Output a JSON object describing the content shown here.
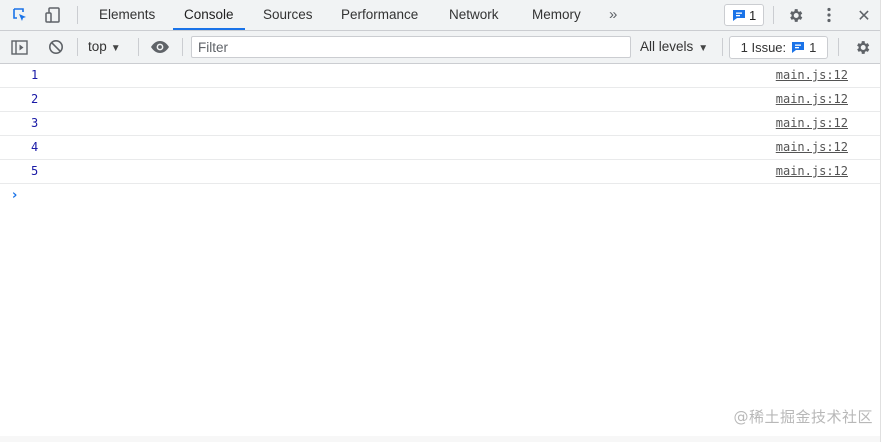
{
  "tabs": [
    {
      "label": "Elements",
      "active": false
    },
    {
      "label": "Console",
      "active": true
    },
    {
      "label": "Sources",
      "active": false
    },
    {
      "label": "Performance",
      "active": false
    },
    {
      "label": "Network",
      "active": false
    },
    {
      "label": "Memory",
      "active": false
    }
  ],
  "more_tabs_glyph": "»",
  "issue_badge_count": "1",
  "close_glyph": "✕",
  "toolbar": {
    "context": "top",
    "filter_placeholder": "Filter",
    "levels": "All levels",
    "issues_label": "1 Issue:",
    "issues_count": "1"
  },
  "messages": [
    {
      "text": "1",
      "source": "main.js:12"
    },
    {
      "text": "2",
      "source": "main.js:12"
    },
    {
      "text": "3",
      "source": "main.js:12"
    },
    {
      "text": "4",
      "source": "main.js:12"
    },
    {
      "text": "5",
      "source": "main.js:12"
    }
  ],
  "prompt_glyph": "›",
  "watermark": "@稀土掘金技术社区",
  "colors": {
    "accent": "#1a73e8",
    "message_text": "#1a1aa6",
    "toolbar_bg": "#f1f3f4"
  },
  "icons": {
    "inspect": "inspect-element-icon",
    "device": "device-toolbar-icon",
    "sidebar": "show-sidebar-icon",
    "clear": "clear-console-icon",
    "eye": "live-expression-icon",
    "settings": "gear-icon",
    "menu": "kebab-menu-icon",
    "issue": "issue-message-icon"
  }
}
